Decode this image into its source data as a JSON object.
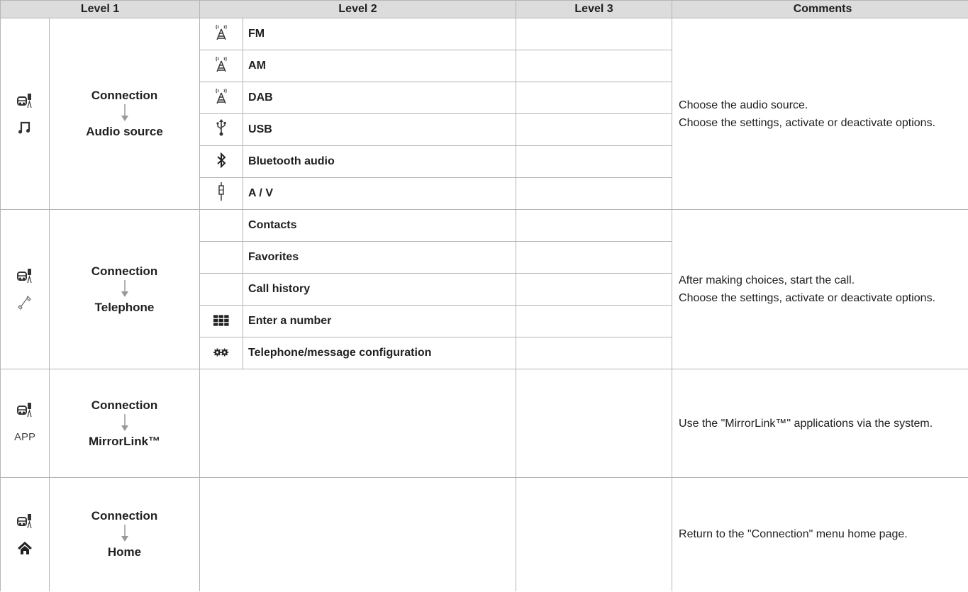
{
  "header": {
    "level1": "Level 1",
    "level2": "Level 2",
    "level3": "Level 3",
    "comments": "Comments"
  },
  "sections": [
    {
      "nav_top": "Connection",
      "nav_bottom": "Audio source",
      "icons": [
        "connection-icon",
        "music-note-icon"
      ],
      "items": [
        {
          "label": "FM",
          "icon": "antenna-icon"
        },
        {
          "label": "AM",
          "icon": "antenna-icon"
        },
        {
          "label": "DAB",
          "icon": "antenna-icon"
        },
        {
          "label": "USB",
          "icon": "usb-icon"
        },
        {
          "label": "Bluetooth audio",
          "icon": "bluetooth-icon"
        },
        {
          "label": "A / V",
          "icon": "av-jack-icon"
        }
      ],
      "comment_lines": [
        "Choose the audio source.",
        "Choose the settings, activate or deactivate options."
      ]
    },
    {
      "nav_top": "Connection",
      "nav_bottom": "Telephone",
      "icons": [
        "connection-icon",
        "telephone-handset-icon"
      ],
      "items": [
        {
          "label": "Contacts",
          "icon": ""
        },
        {
          "label": "Favorites",
          "icon": ""
        },
        {
          "label": "Call history",
          "icon": ""
        },
        {
          "label": "Enter a number",
          "icon": "keypad-icon"
        },
        {
          "label": "Telephone/message configuration",
          "icon": "gears-icon"
        }
      ],
      "comment_lines": [
        "After making choices, start the call.",
        "Choose the settings, activate or deactivate options."
      ]
    },
    {
      "nav_top": "Connection",
      "nav_bottom": "MirrorLink™",
      "icons": [
        "connection-icon",
        "app-icon"
      ],
      "app_label": "APP",
      "comment_lines": [
        "Use the \"MirrorLink™\" applications via the system."
      ]
    },
    {
      "nav_top": "Connection",
      "nav_bottom": "Home",
      "icons": [
        "connection-icon",
        "home-icon"
      ],
      "comment_lines": [
        "Return to the \"Connection\" menu home page."
      ]
    }
  ]
}
